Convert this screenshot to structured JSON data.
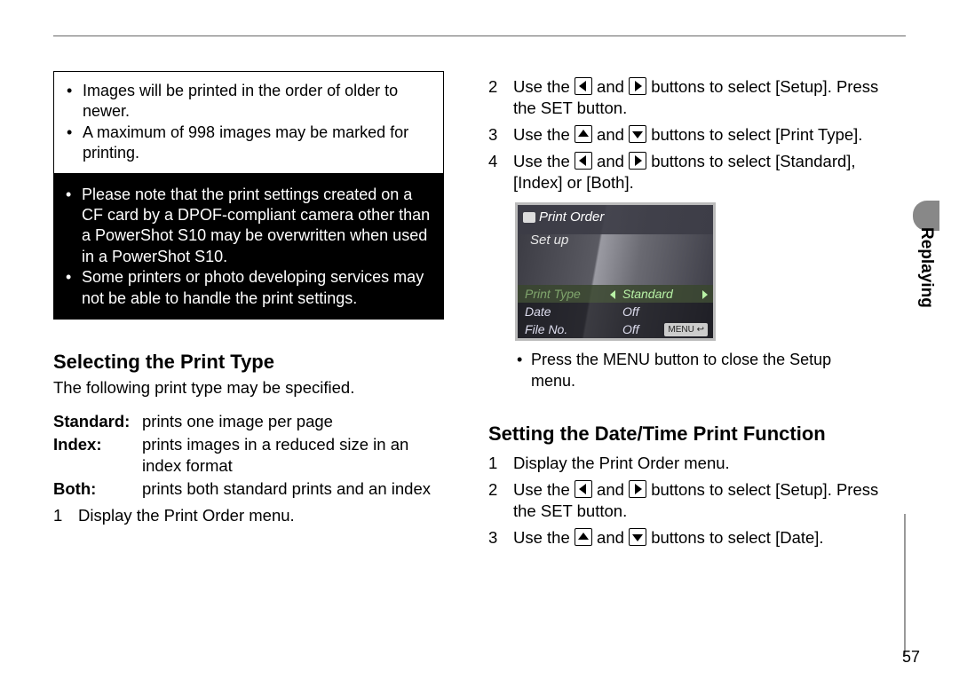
{
  "sideTab": "Replaying",
  "pageNumber": "57",
  "whiteBox": [
    "Images will be printed in the order of older to newer.",
    "A maximum of 998 images may be marked for printing."
  ],
  "blackBox": [
    "Please note that the print settings created on a CF card by a DPOF-compliant camera other than a PowerShot S10 may be overwritten when used in a PowerShot S10.",
    "Some printers or photo developing services may not be able to handle the print settings."
  ],
  "h1": "Selecting the Print Type",
  "h1Intro": "The following print type may be specified.",
  "defs": [
    {
      "term": "Standard:",
      "def": "prints one image per page"
    },
    {
      "term": "Index:",
      "def": "prints images in a reduced size in an index format"
    },
    {
      "term": "Both:",
      "def": "prints both standard prints and an index"
    }
  ],
  "stepA1": {
    "n": "1",
    "t": "Display the Print Order menu."
  },
  "stepB2": {
    "n": "2",
    "pre": "Use the ",
    "mid": " and ",
    "post": " buttons to select [Setup]. Press the SET button."
  },
  "stepB3": {
    "n": "3",
    "pre": "Use the ",
    "mid": " and ",
    "post": " buttons to select [Print Type]."
  },
  "stepB4": {
    "n": "4",
    "pre": "Use the ",
    "mid": " and ",
    "post": " buttons to select [Standard], [Index] or [Both]."
  },
  "lcd": {
    "title": "Print Order",
    "setup": "Set up",
    "rows": [
      {
        "label": "Print Type",
        "value": "Standard",
        "hl": true
      },
      {
        "label": "Date",
        "value": "Off"
      },
      {
        "label": "File No.",
        "value": "Off"
      }
    ],
    "menuBtn": "MENU ↩"
  },
  "closeNote": "Press the MENU button to close the Setup menu.",
  "h2": "Setting the Date/Time Print Function",
  "stepC1": {
    "n": "1",
    "t": "Display the Print Order menu."
  },
  "stepC2": {
    "n": "2",
    "pre": "Use the ",
    "mid": " and ",
    "post": " buttons to select [Setup]. Press the SET button."
  },
  "stepC3": {
    "n": "3",
    "pre": "Use the ",
    "mid": " and ",
    "post": " buttons to select [Date]."
  }
}
